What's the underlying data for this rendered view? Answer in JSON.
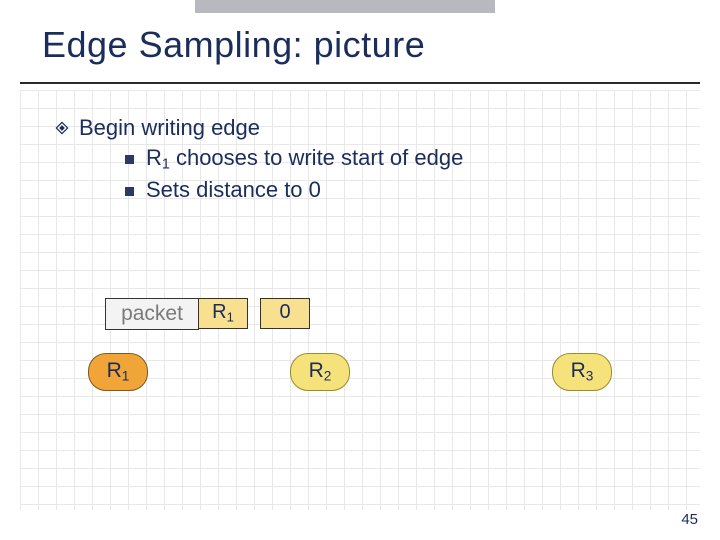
{
  "title": "Edge Sampling: picture",
  "bullet": "Begin writing edge",
  "sub_bullets": [
    {
      "pre": "R",
      "sub": "1",
      "post": " chooses to write start of edge"
    },
    {
      "pre": "Sets distance to 0",
      "sub": "",
      "post": ""
    }
  ],
  "packet": {
    "label": "packet",
    "field_start_pre": "R",
    "field_start_sub": "1",
    "field_dist": "0"
  },
  "nodes": {
    "r1_pre": "R",
    "r1_sub": "1",
    "r2_pre": "R",
    "r2_sub": "2",
    "r3_pre": "R",
    "r3_sub": "3"
  },
  "page_number": "45"
}
